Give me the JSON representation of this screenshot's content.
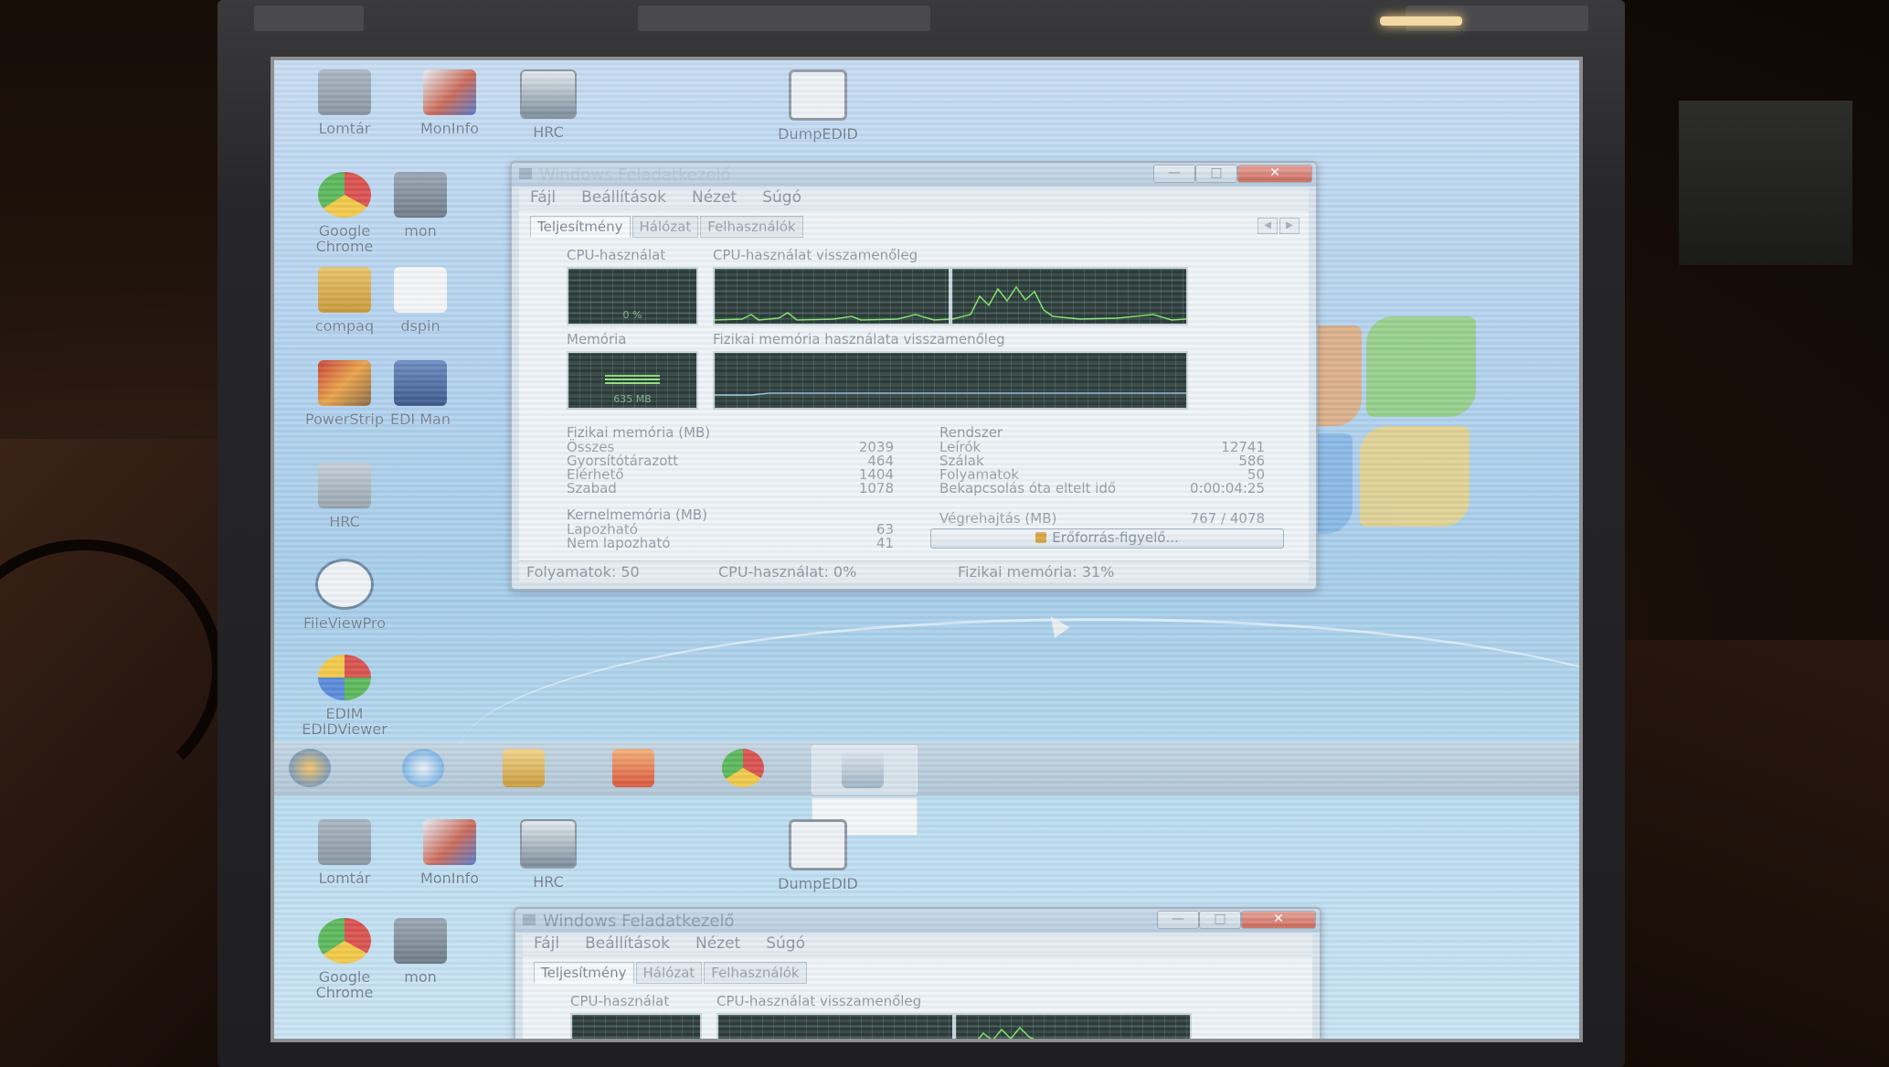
{
  "desktop_icons_top": [
    {
      "label": "Lomtár",
      "icon": "recycle-bin-icon"
    },
    {
      "label": "MonInfo",
      "icon": "moninfo-icon"
    },
    {
      "label": "HRC",
      "icon": "hrc-icon"
    },
    {
      "label": "DumpEDID",
      "icon": "dumpedid-icon"
    },
    {
      "label": "Google Chrome",
      "icon": "chrome-icon"
    },
    {
      "label": "mon",
      "icon": "mon-icon"
    },
    {
      "label": "compaq",
      "icon": "folder-icon"
    },
    {
      "label": "dspin",
      "icon": "dspin-icon"
    },
    {
      "label": "PowerStrip",
      "icon": "powerstrip-icon"
    },
    {
      "label": "EDI Man",
      "icon": "edid-manager-icon"
    },
    {
      "label": "HRC",
      "icon": "hrc-file-icon"
    },
    {
      "label": "FileViewPro",
      "icon": "fileviewpro-icon"
    },
    {
      "label": "EDIM EDIDViewer",
      "icon": "edid-viewer-icon"
    }
  ],
  "task_manager": {
    "title": "Windows Feladatkezelő",
    "menu": [
      "Fájl",
      "Beállítások",
      "Nézet",
      "Súgó"
    ],
    "tabs": [
      "Teljesítmény",
      "Hálózat",
      "Felhasználók"
    ],
    "cpu_usage_label": "CPU-használat",
    "cpu_usage_value": "0 %",
    "cpu_history_label": "CPU-használat visszamenőleg",
    "memory_label": "Memória",
    "memory_value": "635 MB",
    "mem_history_label": "Fizikai memória használata visszamenőleg",
    "physical_memory": {
      "header": "Fizikai memória (MB)",
      "rows": [
        {
          "label": "Összes",
          "value": "2039"
        },
        {
          "label": "Gyorsítótárazott",
          "value": "464"
        },
        {
          "label": "Elérhető",
          "value": "1404"
        },
        {
          "label": "Szabad",
          "value": "1078"
        }
      ]
    },
    "kernel_memory": {
      "header": "Kernelmemória (MB)",
      "rows": [
        {
          "label": "Lapozható",
          "value": "63"
        },
        {
          "label": "Nem lapozható",
          "value": "41"
        }
      ]
    },
    "system": {
      "header": "Rendszer",
      "rows": [
        {
          "label": "Leírók",
          "value": "12741"
        },
        {
          "label": "Szálak",
          "value": "586"
        },
        {
          "label": "Folyamatok",
          "value": "50"
        },
        {
          "label": "Bekapcsolás óta eltelt idő",
          "value": "0:00:04:25"
        },
        {
          "label": "Végrehajtás (MB)",
          "value": "767 / 4078"
        }
      ]
    },
    "resource_monitor_button": "Erőforrás-figyelő...",
    "status": {
      "processes": "Folyamatok: 50",
      "cpu": "CPU-használat: 0%",
      "memory": "Fizikai memória: 31%"
    }
  },
  "taskbar": {
    "items": [
      "start-orb-icon",
      "ie-icon",
      "explorer-icon",
      "media-player-icon",
      "chrome-icon",
      "task-manager-icon"
    ]
  },
  "desktop_icons_bottom": [
    {
      "label": "Lomtár"
    },
    {
      "label": "MonInfo"
    },
    {
      "label": "HRC"
    },
    {
      "label": "DumpEDID"
    },
    {
      "label": "Google Chrome"
    },
    {
      "label": "mon"
    }
  ],
  "task_manager_2": {
    "title": "Windows Feladatkezelő",
    "menu": [
      "Fájl",
      "Beállítások",
      "Nézet",
      "Súgó"
    ],
    "tabs": [
      "Teljesítmény",
      "Hálózat",
      "Felhasználók"
    ],
    "cpu_usage_label": "CPU-használat",
    "cpu_history_label": "CPU-használat visszamenőleg"
  },
  "colors": {
    "desktop": "#b3d2ee",
    "graph_bg": "#2d3d3b",
    "graph_line": "#7fe36a",
    "close_button": "#c9685a"
  }
}
